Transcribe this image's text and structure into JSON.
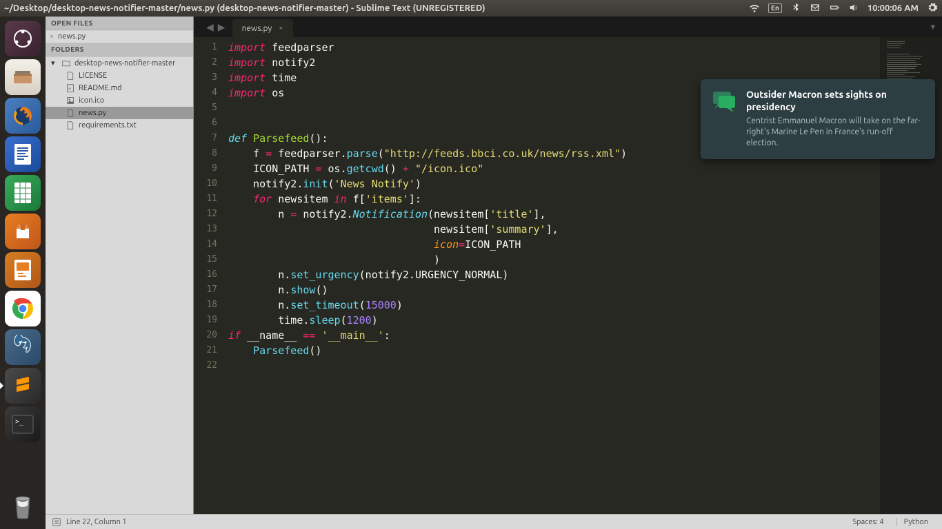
{
  "menubar": {
    "title": "~/Desktop/desktop-news-notifier-master/news.py (desktop-news-notifier-master) - Sublime Text (UNREGISTERED)",
    "lang": "En",
    "clock": "10:00:06 AM"
  },
  "sidebar": {
    "open_files_header": "OPEN FILES",
    "open_files": [
      {
        "name": "news.py"
      }
    ],
    "folders_header": "FOLDERS",
    "root_folder": "desktop-news-notifier-master",
    "files": [
      {
        "name": "LICENSE",
        "icon": "file"
      },
      {
        "name": "README.md",
        "icon": "md"
      },
      {
        "name": "icon.ico",
        "icon": "img"
      },
      {
        "name": "news.py",
        "icon": "file",
        "selected": true
      },
      {
        "name": "requirements.txt",
        "icon": "file"
      }
    ]
  },
  "tabs": {
    "active": "news.py"
  },
  "code": {
    "lines": [
      {
        "n": 1,
        "tokens": [
          [
            "kw",
            "import"
          ],
          [
            "sp",
            " "
          ],
          [
            "var",
            "feedparser"
          ]
        ]
      },
      {
        "n": 2,
        "tokens": [
          [
            "kw",
            "import"
          ],
          [
            "sp",
            " "
          ],
          [
            "var",
            "notify2"
          ]
        ]
      },
      {
        "n": 3,
        "tokens": [
          [
            "kw",
            "import"
          ],
          [
            "sp",
            " "
          ],
          [
            "var",
            "time"
          ]
        ]
      },
      {
        "n": 4,
        "tokens": [
          [
            "kw",
            "import"
          ],
          [
            "sp",
            " "
          ],
          [
            "var",
            "os"
          ]
        ]
      },
      {
        "n": 5,
        "tokens": []
      },
      {
        "n": 6,
        "tokens": []
      },
      {
        "n": 7,
        "tokens": [
          [
            "cl",
            "def"
          ],
          [
            "sp",
            " "
          ],
          [
            "fn",
            "Parsefeed"
          ],
          [
            "var",
            "():"
          ]
        ]
      },
      {
        "n": 8,
        "tokens": [
          [
            "sp",
            "    "
          ],
          [
            "var",
            "f "
          ],
          [
            "op",
            "="
          ],
          [
            "sp",
            " "
          ],
          [
            "var",
            "feedparser"
          ],
          [
            "var",
            "."
          ],
          [
            "bi",
            "parse"
          ],
          [
            "var",
            "("
          ],
          [
            "str",
            "\"http://feeds.bbci.co.uk/news/rss.xml\""
          ],
          [
            "var",
            ")"
          ]
        ]
      },
      {
        "n": 9,
        "tokens": [
          [
            "sp",
            "    "
          ],
          [
            "var",
            "ICON_PATH "
          ],
          [
            "op",
            "="
          ],
          [
            "sp",
            " "
          ],
          [
            "var",
            "os"
          ],
          [
            "var",
            "."
          ],
          [
            "bi",
            "getcwd"
          ],
          [
            "var",
            "() "
          ],
          [
            "op",
            "+"
          ],
          [
            "sp",
            " "
          ],
          [
            "str",
            "\"/icon.ico\""
          ]
        ]
      },
      {
        "n": 10,
        "tokens": [
          [
            "sp",
            "    "
          ],
          [
            "var",
            "notify2"
          ],
          [
            "var",
            "."
          ],
          [
            "bi",
            "init"
          ],
          [
            "var",
            "("
          ],
          [
            "str",
            "'News Notify'"
          ],
          [
            "var",
            ")"
          ]
        ]
      },
      {
        "n": 11,
        "tokens": [
          [
            "sp",
            "    "
          ],
          [
            "kw",
            "for"
          ],
          [
            "sp",
            " "
          ],
          [
            "var",
            "newsitem "
          ],
          [
            "kw",
            "in"
          ],
          [
            "sp",
            " "
          ],
          [
            "var",
            "f["
          ],
          [
            "str",
            "'items'"
          ],
          [
            "var",
            "]:"
          ]
        ]
      },
      {
        "n": 12,
        "tokens": [
          [
            "sp",
            "        "
          ],
          [
            "var",
            "n "
          ],
          [
            "op",
            "="
          ],
          [
            "sp",
            " "
          ],
          [
            "var",
            "notify2"
          ],
          [
            "var",
            "."
          ],
          [
            "cl",
            "Notification"
          ],
          [
            "var",
            "(newsitem["
          ],
          [
            "str",
            "'title'"
          ],
          [
            "var",
            "],"
          ]
        ]
      },
      {
        "n": 13,
        "tokens": [
          [
            "sp",
            "                                 "
          ],
          [
            "var",
            "newsitem["
          ],
          [
            "str",
            "'summary'"
          ],
          [
            "var",
            "],"
          ]
        ]
      },
      {
        "n": 14,
        "tokens": [
          [
            "sp",
            "                                 "
          ],
          [
            "arg",
            "icon"
          ],
          [
            "op",
            "="
          ],
          [
            "var",
            "ICON_PATH"
          ]
        ]
      },
      {
        "n": 15,
        "tokens": [
          [
            "sp",
            "                                 "
          ],
          [
            "var",
            ")"
          ]
        ]
      },
      {
        "n": 16,
        "tokens": [
          [
            "sp",
            "        "
          ],
          [
            "var",
            "n"
          ],
          [
            "var",
            "."
          ],
          [
            "bi",
            "set_urgency"
          ],
          [
            "var",
            "(notify2"
          ],
          [
            "var",
            "."
          ],
          [
            "var",
            "URGENCY_NORMAL)"
          ]
        ]
      },
      {
        "n": 17,
        "tokens": [
          [
            "sp",
            "        "
          ],
          [
            "var",
            "n"
          ],
          [
            "var",
            "."
          ],
          [
            "bi",
            "show"
          ],
          [
            "var",
            "()"
          ]
        ]
      },
      {
        "n": 18,
        "tokens": [
          [
            "sp",
            "        "
          ],
          [
            "var",
            "n"
          ],
          [
            "var",
            "."
          ],
          [
            "bi",
            "set_timeout"
          ],
          [
            "var",
            "("
          ],
          [
            "num",
            "15000"
          ],
          [
            "var",
            ")"
          ]
        ]
      },
      {
        "n": 19,
        "tokens": [
          [
            "sp",
            "        "
          ],
          [
            "var",
            "time"
          ],
          [
            "var",
            "."
          ],
          [
            "bi",
            "sleep"
          ],
          [
            "var",
            "("
          ],
          [
            "num",
            "1200"
          ],
          [
            "var",
            ")"
          ]
        ]
      },
      {
        "n": 20,
        "tokens": [
          [
            "kw",
            "if"
          ],
          [
            "sp",
            " "
          ],
          [
            "var",
            "__name__ "
          ],
          [
            "op",
            "=="
          ],
          [
            "sp",
            " "
          ],
          [
            "str",
            "'__main__'"
          ],
          [
            "var",
            ":"
          ]
        ]
      },
      {
        "n": 21,
        "tokens": [
          [
            "sp",
            "    "
          ],
          [
            "bi",
            "Parsefeed"
          ],
          [
            "var",
            "()"
          ]
        ]
      },
      {
        "n": 22,
        "tokens": []
      }
    ]
  },
  "statusbar": {
    "position": "Line 22, Column 1",
    "spaces": "Spaces: 4",
    "syntax": "Python"
  },
  "notification": {
    "title": "Outsider Macron sets sights on presidency",
    "body": "Centrist Emmanuel Macron will take on the far-right's Marine Le Pen in France's run-off election."
  }
}
